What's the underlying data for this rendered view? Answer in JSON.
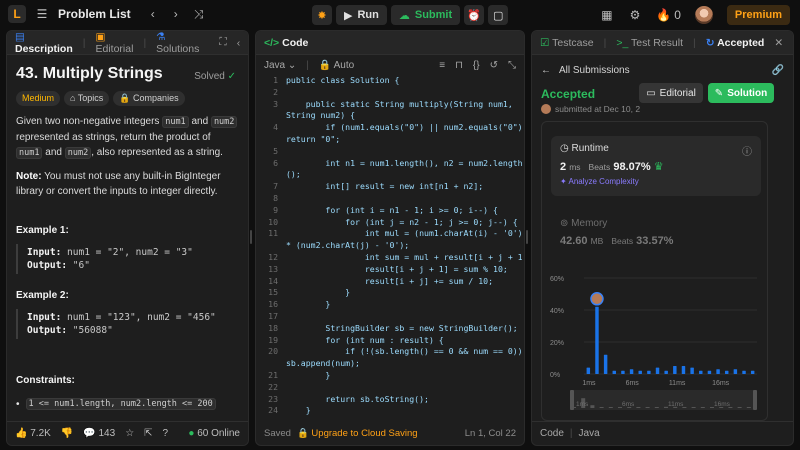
{
  "topbar": {
    "logo": "L",
    "title": "Problem List",
    "run_label": "Run",
    "submit_label": "Submit",
    "streak_count": "0",
    "premium_label": "Premium"
  },
  "left": {
    "tabs": [
      "Description",
      "Editorial",
      "Solutions"
    ],
    "title": "43. Multiply Strings",
    "solved_label": "Solved",
    "chips": [
      "Medium",
      "Topics",
      "Companies"
    ],
    "desc_1a": "Given two non-negative integers ",
    "num1": "num1",
    "desc_1b": " and ",
    "num2": "num2",
    "desc_1c": " represented as strings, return the product of ",
    "desc_1d": " and ",
    "desc_1e": ", also represented as a string.",
    "note_b": "Note:",
    "note_text": " You must not use any built-in BigInteger library or convert the inputs to integer directly.",
    "ex1_title": "Example 1:",
    "ex1_input_label": "Input:",
    "ex1_input": " num1 = \"2\", num2 = \"3\"",
    "ex1_output_label": "Output:",
    "ex1_output": " \"6\"",
    "ex2_title": "Example 2:",
    "ex2_input_label": "Input:",
    "ex2_input": " num1 = \"123\", num2 = \"456\"",
    "ex2_output_label": "Output:",
    "ex2_output": " \"56088\"",
    "constraints_title": "Constraints:",
    "constraint_1": "1 <= num1.length, num2.length <= 200",
    "likes": "7.2K",
    "comments": "143",
    "online": "60 Online"
  },
  "code": {
    "tab": "Code",
    "language": "Java",
    "mode": "Auto",
    "lines": [
      {
        "n": "1",
        "t": "public class Solution {"
      },
      {
        "n": "2",
        "t": ""
      },
      {
        "n": "3",
        "t": "    public static String multiply(String num1,"
      },
      {
        "n": "",
        "t": "String num2) {"
      },
      {
        "n": "4",
        "t": "        if (num1.equals(\"0\") || num2.equals(\"0\"))"
      },
      {
        "n": "",
        "t": "return \"0\";"
      },
      {
        "n": "5",
        "t": ""
      },
      {
        "n": "6",
        "t": "        int n1 = num1.length(), n2 = num2.length"
      },
      {
        "n": "",
        "t": "();"
      },
      {
        "n": "7",
        "t": "        int[] result = new int[n1 + n2];"
      },
      {
        "n": "8",
        "t": ""
      },
      {
        "n": "9",
        "t": "        for (int i = n1 - 1; i >= 0; i--) {"
      },
      {
        "n": "10",
        "t": "            for (int j = n2 - 1; j >= 0; j--) {"
      },
      {
        "n": "11",
        "t": "                int mul = (num1.charAt(i) - '0')"
      },
      {
        "n": "",
        "t": "* (num2.charAt(j) - '0');"
      },
      {
        "n": "12",
        "t": "                int sum = mul + result[i + j + 1];"
      },
      {
        "n": "13",
        "t": "                result[i + j + 1] = sum % 10;"
      },
      {
        "n": "14",
        "t": "                result[i + j] += sum / 10;"
      },
      {
        "n": "15",
        "t": "            }"
      },
      {
        "n": "16",
        "t": "        }"
      },
      {
        "n": "17",
        "t": ""
      },
      {
        "n": "18",
        "t": "        StringBuilder sb = new StringBuilder();"
      },
      {
        "n": "19",
        "t": "        for (int num : result) {"
      },
      {
        "n": "20",
        "t": "            if (!(sb.length() == 0 && num == 0))"
      },
      {
        "n": "",
        "t": "sb.append(num);"
      },
      {
        "n": "21",
        "t": "        }"
      },
      {
        "n": "22",
        "t": ""
      },
      {
        "n": "23",
        "t": "        return sb.toString();"
      },
      {
        "n": "24",
        "t": "    }"
      },
      {
        "n": "25",
        "t": "}"
      }
    ],
    "saved": "Saved",
    "upgrade": "Upgrade to Cloud Saving",
    "cursor": "Ln 1, Col 22"
  },
  "right": {
    "tabs": [
      "Testcase",
      "Test Result",
      "Accepted"
    ],
    "all_submissions": "All Submissions",
    "accepted": "Accepted",
    "submitted": "submitted at Dec 10, 2",
    "editorial_btn": "Editorial",
    "solution_btn": "Solution",
    "runtime_label": "Runtime",
    "runtime_value": "2",
    "runtime_unit": "ms",
    "beats_label": "Beats",
    "runtime_beats": "98.07%",
    "analyze": "Analyze Complexity",
    "memory_label": "Memory",
    "memory_value": "42.60",
    "memory_unit": "MB",
    "memory_beats": "33.57%",
    "code_label": "Code",
    "code_lang": "Java"
  },
  "chart_data": {
    "type": "bar",
    "yticks": [
      "60%",
      "40%",
      "20%",
      "0%"
    ],
    "xticks": [
      "1ms",
      "6ms",
      "11ms",
      "16ms"
    ],
    "ylim": [
      0,
      60
    ],
    "x": [
      1,
      2,
      3,
      4,
      5,
      6,
      7,
      8,
      9,
      10,
      11,
      12,
      13,
      14,
      15,
      16,
      17,
      18,
      19,
      20
    ],
    "values": [
      4,
      42,
      12,
      2,
      2,
      3,
      2,
      2,
      4,
      2,
      5,
      5,
      4,
      2,
      2,
      3,
      2,
      3,
      2,
      2
    ],
    "highlight_index": 1,
    "color": "#1a73e8"
  }
}
